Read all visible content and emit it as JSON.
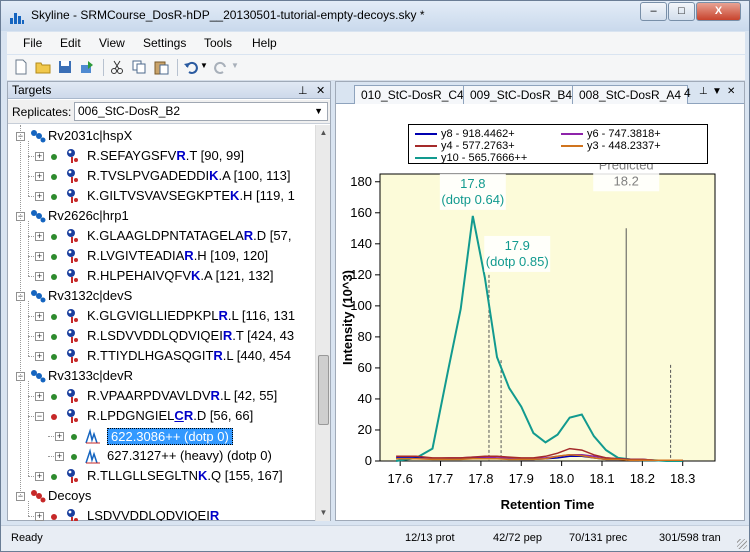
{
  "window": {
    "title": "Skyline - SRMCourse_DosR-hDP__20130501-tutorial-empty-decoys.sky *",
    "min": "–",
    "max": "□",
    "close": "X"
  },
  "menu": [
    "File",
    "Edit",
    "View",
    "Settings",
    "Tools",
    "Help"
  ],
  "toolbar": [
    "new-file-icon",
    "open-folder-icon",
    "save-icon",
    "import-results-icon",
    "cut-icon",
    "copy-icon",
    "paste-icon",
    "undo-icon",
    "redo-icon"
  ],
  "targets": {
    "title": "Targets",
    "pin": "⊥",
    "close": "✕",
    "replicates_label": "Replicates:",
    "replicate": "006_StC-DosR_B2",
    "rows": [
      {
        "k": "prot",
        "text": "Rv2031c|hspX"
      },
      {
        "k": "pep",
        "pre": "R.SEFAYGSFV",
        "bold": "R",
        "post": ".T [90, 99]"
      },
      {
        "k": "pep",
        "pre": "R.TVSLPVGADEDDI",
        "bold": "K",
        "post": ".A [100, 113]"
      },
      {
        "k": "pep",
        "pre": "K.GILTVSVAVSEGKPTE",
        "bold": "K",
        "post": ".H [119, 1"
      },
      {
        "k": "prot",
        "text": "Rv2626c|hrp1"
      },
      {
        "k": "pep",
        "pre": "K.GLAAGLDPNTATAGELA",
        "bold": "R",
        "post": ".D [57,"
      },
      {
        "k": "pep",
        "pre": "R.LVGIVTEADIA",
        "bold": "R",
        "post": ".H [109, 120]"
      },
      {
        "k": "pep",
        "pre": "R.HLPEHAIVQFV",
        "bold": "K",
        "post": ".A [121, 132]"
      },
      {
        "k": "prot",
        "text": "Rv3132c|devS"
      },
      {
        "k": "pep",
        "pre": "K.GLGVIGLLIEDPKPL",
        "bold": "R",
        "post": ".L [116, 131"
      },
      {
        "k": "pep",
        "pre": "R.LSDVVDDLQDVIQEI",
        "bold": "R",
        "post": ".T [424, 43"
      },
      {
        "k": "pep",
        "pre": "R.TTIYDLHGASQGIT",
        "bold": "R",
        "post": ".L [440, 454"
      },
      {
        "k": "prot",
        "text": "Rv3133c|devR"
      },
      {
        "k": "pep",
        "pre": "R.VPAARPDVAVLDV",
        "bold": "R",
        "post": ".L [42, 55]"
      },
      {
        "k": "pep",
        "pre": "R.LPDGNGIEL",
        "bold": "CR",
        "post": ".D [56, 66]",
        "expanded": true,
        "red": true
      },
      {
        "k": "prec",
        "text": "622.3086++ (dotp 0)",
        "selected": true
      },
      {
        "k": "prec",
        "text": "627.3127++ (heavy) (dotp 0)"
      },
      {
        "k": "pep",
        "pre": "R.TLLGLLSEGLTN",
        "bold": "K",
        "post": ".Q [155, 167]"
      },
      {
        "k": "prot",
        "text": "Decoys",
        "decoy": true
      },
      {
        "k": "pep",
        "pre": "LSDVVDDLQDVIQEI",
        "bold": "R",
        "post": "",
        "red": true
      }
    ]
  },
  "tabs": [
    "010_StC-DosR_C4",
    "009_StC-DosR_B4",
    "008_StC-DosR_A4"
  ],
  "tab_overflow": "4",
  "chart_data": {
    "type": "line",
    "xlabel": "Retention Time",
    "ylabel": "Intensity (10^3)",
    "xlim": [
      17.55,
      18.38
    ],
    "ylim": [
      0,
      185
    ],
    "xticks": [
      17.6,
      17.7,
      17.8,
      17.9,
      18.0,
      18.1,
      18.2,
      18.3
    ],
    "yticks": [
      0,
      20,
      40,
      60,
      80,
      100,
      120,
      140,
      160,
      180
    ],
    "x": [
      17.53,
      17.59,
      17.64,
      17.68,
      17.72,
      17.75,
      17.78,
      17.81,
      17.84,
      17.87,
      17.9,
      17.93,
      17.96,
      17.99,
      18.02,
      18.05,
      18.08,
      18.11,
      18.14,
      18.17,
      18.2,
      18.23,
      18.26,
      18.3
    ],
    "series": [
      {
        "name": "y8 - 918.4462+",
        "color": "#0000b0",
        "values": [
          1,
          2,
          2,
          1.5,
          1.5,
          1.5,
          2,
          2,
          1.5,
          1.5,
          1,
          1,
          1.5,
          2,
          3,
          3,
          2,
          1,
          1,
          1,
          1,
          0.5,
          0.5,
          0.5
        ]
      },
      {
        "name": "y6 - 747.3818+",
        "color": "#8e24aa",
        "values": [
          1,
          1.5,
          1.5,
          1.5,
          2,
          2,
          2.5,
          2.5,
          2,
          2,
          1.5,
          1.5,
          2,
          3,
          4,
          4,
          3,
          2,
          1.5,
          1,
          1,
          0.5,
          0.5,
          0.5
        ]
      },
      {
        "name": "y4 - 577.2763+",
        "color": "#a52a2a",
        "values": [
          2,
          3,
          3,
          2,
          2,
          2,
          2.5,
          3,
          3,
          2.5,
          2,
          2,
          3,
          5,
          8,
          7,
          4,
          2,
          1.5,
          1,
          1,
          0.5,
          0.5,
          0.5
        ]
      },
      {
        "name": "y3 - 448.2337+",
        "color": "#d0741e",
        "values": [
          1,
          1.5,
          1.5,
          1,
          1,
          1,
          1.5,
          1.5,
          1.5,
          1,
          1,
          1,
          1.5,
          3,
          4,
          3.5,
          2,
          1,
          1,
          0.5,
          0.5,
          0.5,
          0.5,
          0.5
        ]
      },
      {
        "name": "y10 - 565.7666++",
        "color": "#129a8f",
        "values": [
          0,
          0,
          2,
          8,
          60,
          98,
          158,
          118,
          67,
          47,
          35,
          18,
          12,
          17,
          28,
          30,
          16,
          7,
          2,
          1,
          0.5,
          0.5,
          0,
          0
        ]
      }
    ],
    "annotations": [
      {
        "line1": "17.8",
        "line2": "(dotp 0.64)",
        "x": 17.78,
        "y": 158,
        "color": "#129a8f"
      },
      {
        "line1": "17.9",
        "line2": "(dotp 0.85)",
        "x": 17.89,
        "y": 118,
        "color": "#129a8f"
      },
      {
        "line1": "Predicted",
        "line2": "18.2",
        "x": 18.16,
        "y": 170,
        "color": "#808080"
      }
    ],
    "shade": [
      17.55,
      18.38
    ],
    "vlines": [
      {
        "x": 17.82,
        "dashed": true,
        "top": 120
      },
      {
        "x": 17.85,
        "dashed": true,
        "top": 65
      },
      {
        "x": 18.16,
        "dashed": false,
        "top": 150
      },
      {
        "x": 18.27,
        "dashed": true,
        "top": 62
      }
    ]
  },
  "status": {
    "left": "Ready",
    "prot": "12/13 prot",
    "pep": "42/72 pep",
    "prec": "70/131 prec",
    "tran": "301/598 tran"
  }
}
